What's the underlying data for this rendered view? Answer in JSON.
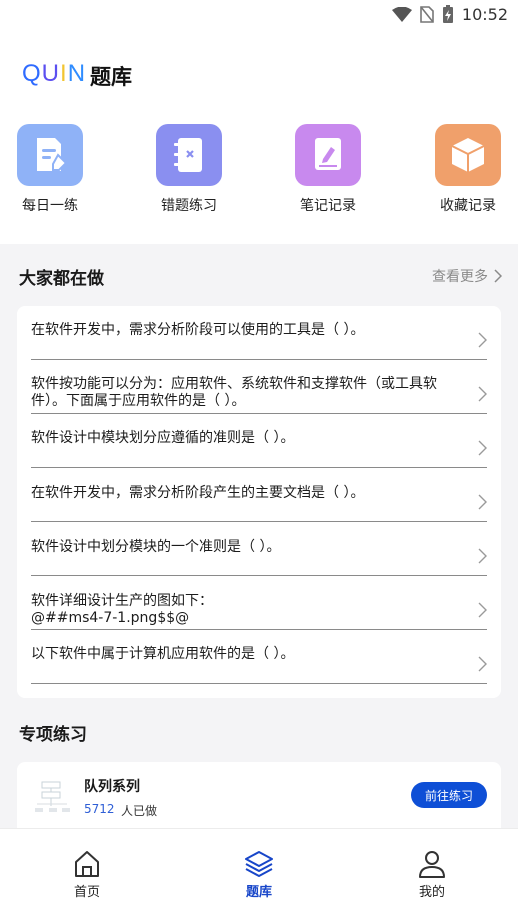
{
  "status_bar": {
    "time": "10:52"
  },
  "header": {
    "logo_text": [
      "Q",
      "U",
      "I",
      "N"
    ],
    "title": "题库"
  },
  "quick_actions": [
    {
      "label": "每日一练",
      "icon": "daily-edit-icon",
      "color": "#8fb2f7"
    },
    {
      "label": "错题练习",
      "icon": "wrong-book-icon",
      "color": "#8a8ff0"
    },
    {
      "label": "笔记记录",
      "icon": "note-icon",
      "color": "#c889ee"
    },
    {
      "label": "收藏记录",
      "icon": "favorite-box-icon",
      "color": "#f0a06b"
    }
  ],
  "popular": {
    "title": "大家都在做",
    "more_label": "查看更多",
    "questions": [
      "在软件开发中，需求分析阶段可以使用的工具是（ ）。",
      "软件按功能可以分为：应用软件、系统软件和支撑软件（或工具软件）。下面属于应用软件的是（ ）。",
      "软件设计中模块划分应遵循的准则是（ ）。",
      "在软件开发中，需求分析阶段产生的主要文档是（ ）。",
      "软件设计中划分模块的一个准则是（ ）。",
      "软件详细设计生产的图如下：\n@##ms4-7-1.png$$@",
      "以下软件中属于计算机应用软件的是（ ）。"
    ]
  },
  "special": {
    "title": "专项练习",
    "item": {
      "name": "队列系列",
      "count": "5712",
      "count_suffix": "人已做",
      "button": "前往练习"
    }
  },
  "tabs": [
    {
      "label": "首页",
      "icon": "home-icon",
      "active": false
    },
    {
      "label": "题库",
      "icon": "layers-icon",
      "active": true
    },
    {
      "label": "我的",
      "icon": "user-icon",
      "active": false
    }
  ],
  "colors": {
    "accent": "#1846c9",
    "button": "#0e4fd6"
  }
}
